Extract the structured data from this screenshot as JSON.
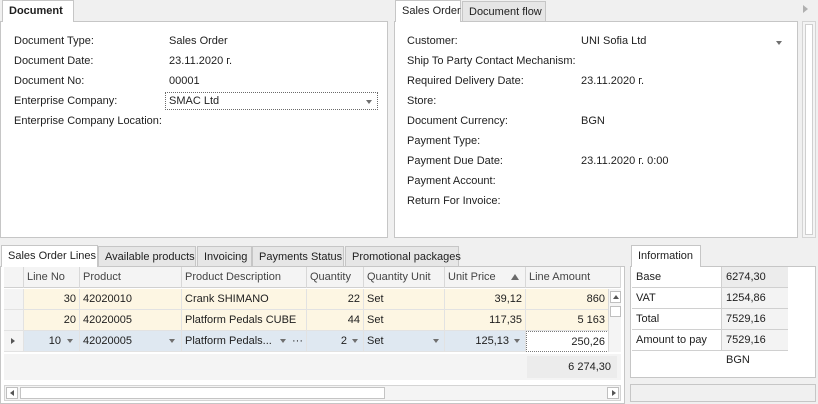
{
  "document_panel": {
    "tab_label": "Document",
    "fields": [
      {
        "label": "Document Type:",
        "value": "Sales Order"
      },
      {
        "label": "Document Date:",
        "value": "23.11.2020 г."
      },
      {
        "label": "Document No:",
        "value": "00001"
      },
      {
        "label": "Enterprise Company:",
        "value": "SMAC Ltd"
      },
      {
        "label": "Enterprise Company Location:",
        "value": ""
      }
    ]
  },
  "sales_order_panel": {
    "tabs": [
      "Sales Order",
      "Document flow"
    ],
    "fields": [
      {
        "label": "Customer:",
        "value": "UNI Sofia Ltd"
      },
      {
        "label": "Ship To Party Contact Mechanism:",
        "value": ""
      },
      {
        "label": "Required Delivery Date:",
        "value": "23.11.2020 г."
      },
      {
        "label": "Store:",
        "value": ""
      },
      {
        "label": "Document Currency:",
        "value": "BGN"
      },
      {
        "label": "Payment Type:",
        "value": ""
      },
      {
        "label": "Payment Due Date:",
        "value": "23.11.2020 г. 0:00"
      },
      {
        "label": "Payment Account:",
        "value": ""
      },
      {
        "label": "Return For Invoice:",
        "value": ""
      }
    ]
  },
  "lines_panel": {
    "tabs": [
      "Sales Order Lines",
      "Available products",
      "Invoicing",
      "Payments Status",
      "Promotional packages"
    ],
    "columns": [
      "Line No",
      "Product",
      "Product Description",
      "Quantity",
      "Quantity Unit",
      "Unit Price",
      "Line Amount"
    ],
    "rows": [
      {
        "line_no": "30",
        "product": "42020010",
        "description": "Crank SHIMANO",
        "quantity": "22",
        "unit": "Set",
        "unit_price": "39,12",
        "amount": "860"
      },
      {
        "line_no": "20",
        "product": "42020005",
        "description": "Platform Pedals CUBE",
        "quantity": "44",
        "unit": "Set",
        "unit_price": "117,35",
        "amount": "5 163"
      },
      {
        "line_no": "10",
        "product": "42020005",
        "description": "Platform Pedals...",
        "quantity": "2",
        "unit": "Set",
        "unit_price": "125,13",
        "amount": "250,26"
      }
    ],
    "total": "6 274,30",
    "ellipsis": "···"
  },
  "info_panel": {
    "tab_label": "Information",
    "rows": [
      {
        "label": "Base",
        "value": "6274,30 BGN"
      },
      {
        "label": "VAT",
        "value": "1254,86 BGN"
      },
      {
        "label": "Total",
        "value": "7529,16 BGN"
      },
      {
        "label": "Amount to pay",
        "value": "7529,16 BGN"
      }
    ]
  },
  "colors": {
    "row_highlight": "#fdf6e3",
    "selected_row": "#dfe8f1",
    "border": "#c6c6c6"
  },
  "icons": [
    "chevron-down-icon",
    "sort-ascending-icon",
    "row-indicator-icon",
    "scroll-up-icon",
    "scroll-down-icon",
    "scroll-left-icon",
    "scroll-right-icon",
    "overflow-arrow-icon"
  ]
}
